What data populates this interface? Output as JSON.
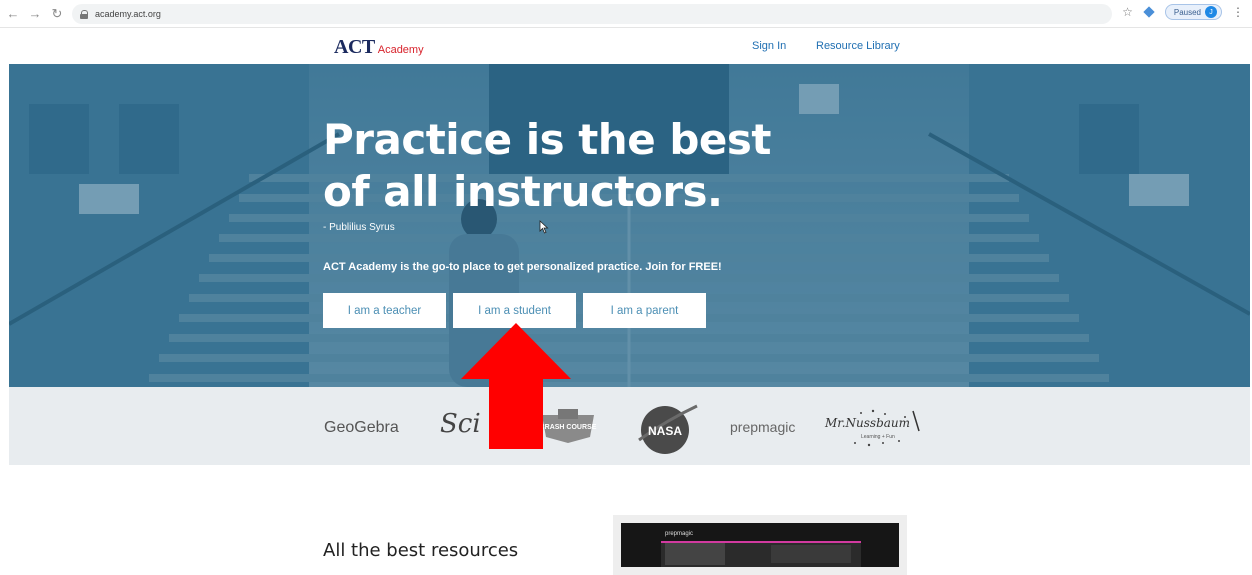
{
  "browser": {
    "url": "academy.act.org",
    "profile_status": "Paused",
    "profile_initial": "J"
  },
  "header": {
    "logo_act": "ACT",
    "logo_academy": "Academy",
    "sign_in": "Sign In",
    "resource_library": "Resource Library"
  },
  "hero": {
    "title_line1": "Practice is the best",
    "title_line2": "of all instructors.",
    "author": "- Publilius Syrus",
    "tagline": "ACT Academy is the go-to place to get personalized practice. Join for FREE!",
    "buttons": {
      "teacher": "I am a teacher",
      "student": "I am a student",
      "parent": "I am a parent"
    }
  },
  "partners": {
    "geogebra": "GeoGebra",
    "sci": "Sci",
    "crash_course": "CRASH COURSE",
    "nasa": "NASA",
    "prepmagic": "prepmagic",
    "nussbaum": "Mr.Nussbaum",
    "nussbaum_sub": "Learning + Fun"
  },
  "content": {
    "resources_heading": "All the best resources"
  },
  "preview": {
    "brand": "prepmagic"
  },
  "colors": {
    "hero_overlay": "#1c6087",
    "button_text": "#4c8fb4",
    "link": "#1f6fb2",
    "arrow": "#ff0000",
    "logo_red": "#d8242d",
    "logo_navy": "#1b2a5e"
  }
}
